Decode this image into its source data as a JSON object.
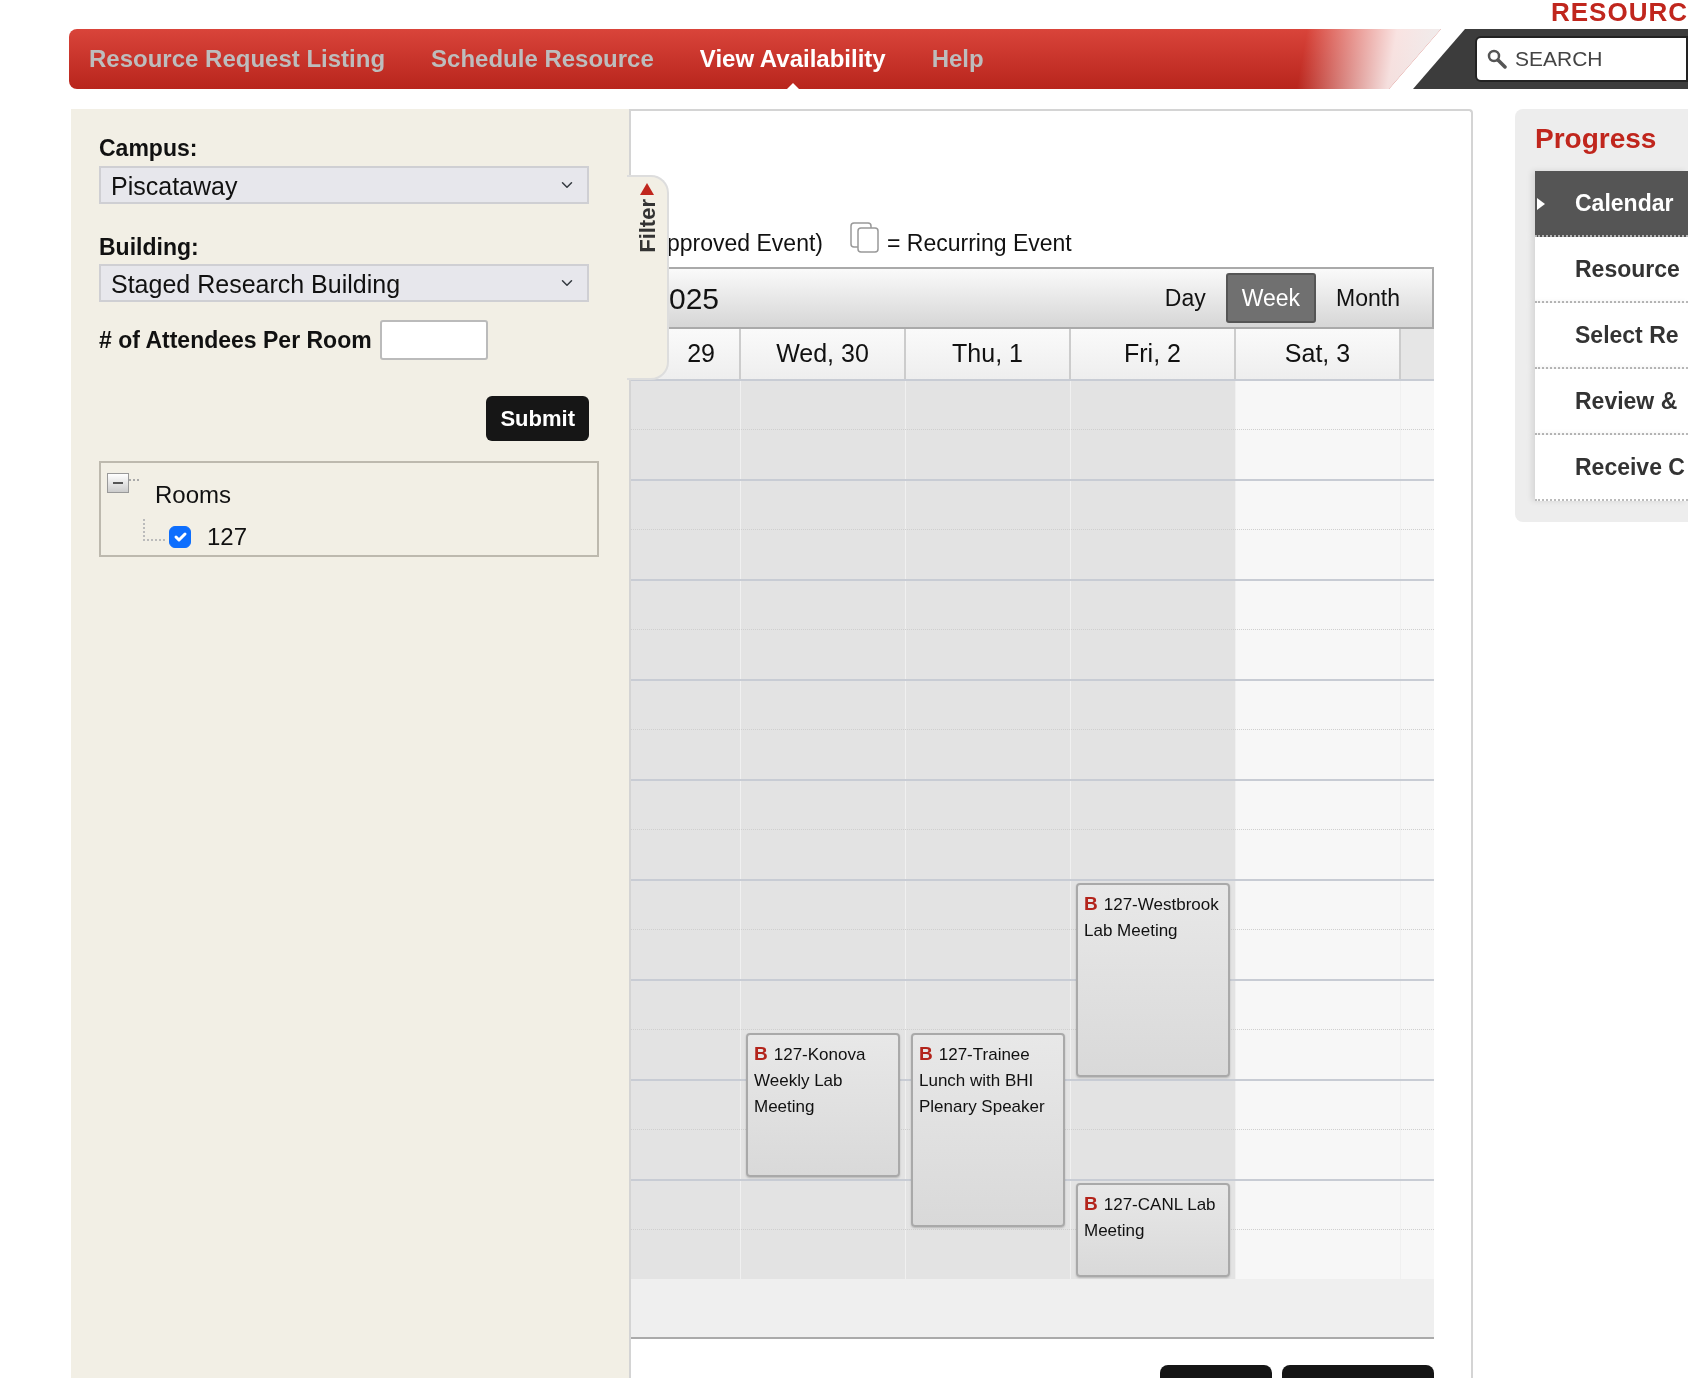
{
  "logo_fragment": "RESOURC",
  "nav": {
    "items": [
      {
        "label": "Resource Request Listing",
        "selected": false
      },
      {
        "label": "Schedule Resource",
        "selected": false
      },
      {
        "label": "View Availability",
        "selected": true
      },
      {
        "label": "Help",
        "selected": false
      }
    ]
  },
  "search": {
    "placeholder": "SEARCH"
  },
  "filter": {
    "tab_label": "Filter",
    "expanded": true,
    "campus": {
      "label": "Campus:",
      "value": "Piscataway"
    },
    "building": {
      "label": "Building:",
      "value": "Staged Research Building"
    },
    "attendees": {
      "label": "# of Attendees Per Room"
    },
    "submit": "Submit",
    "tree": {
      "label": "Rooms",
      "expanded": true,
      "children": [
        {
          "label": "127",
          "checked": true
        }
      ]
    }
  },
  "calendar": {
    "legend": [
      "pproved Event)",
      "= Recurring Event"
    ],
    "title": "025",
    "views": [
      {
        "label": "Day",
        "selected": false
      },
      {
        "label": "Week",
        "selected": true
      },
      {
        "label": "Month",
        "selected": false
      }
    ],
    "days": [
      {
        "label": "29",
        "shaded": true
      },
      {
        "label": "Wed, 30",
        "shaded": true,
        "events": [
          {
            "badge": "B",
            "title": "127-Konova Weekly Lab Meeting"
          }
        ]
      },
      {
        "label": "Thu, 1",
        "shaded": true,
        "events": [
          {
            "badge": "B",
            "title": "127-Trainee Lunch with BHI Plenary Speaker"
          }
        ]
      },
      {
        "label": "Fri, 2",
        "shaded": true,
        "events": [
          {
            "badge": "B",
            "title": "127-Westbrook Lab Meeting"
          },
          {
            "badge": "B",
            "title": "127-CANL Lab Meeting"
          }
        ]
      },
      {
        "label": "Sat, 3",
        "shaded": false
      }
    ]
  },
  "progress": {
    "title": "Progress",
    "steps": [
      {
        "label": "Calendar",
        "selected": true
      },
      {
        "label": "Resource",
        "selected": false
      },
      {
        "label": "Select Re",
        "selected": false
      },
      {
        "label": "Review &",
        "selected": false
      },
      {
        "label": "Receive C",
        "selected": false
      }
    ]
  }
}
